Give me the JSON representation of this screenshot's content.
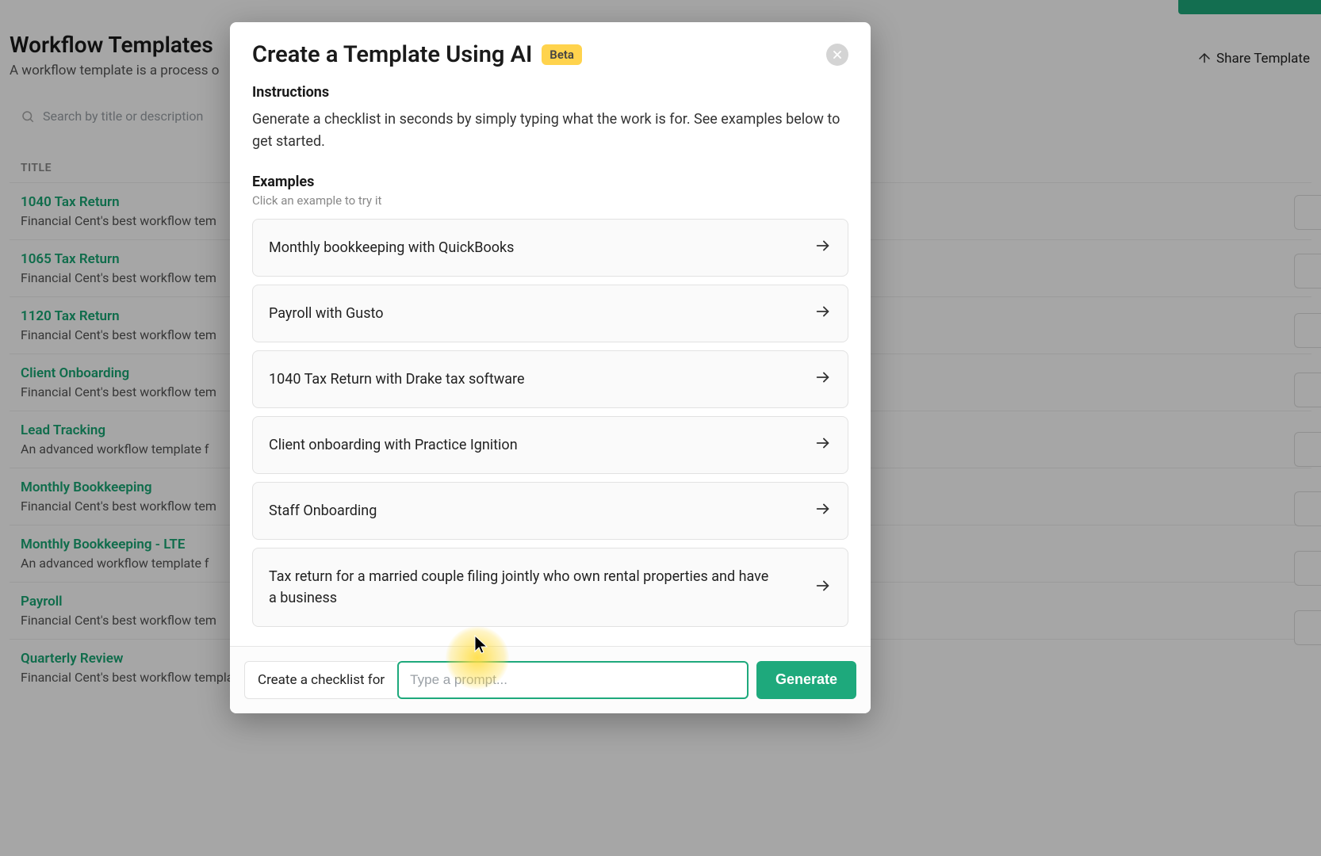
{
  "page": {
    "title": "Workflow Templates",
    "subtitle": "A workflow template is a process o",
    "share_button": "Share Template",
    "search_placeholder": "Search by title or description",
    "column_header": "TITLE",
    "rows": [
      {
        "title": "1040 Tax Return",
        "subtitle": "Financial Cent's best workflow tem"
      },
      {
        "title": "1065 Tax Return",
        "subtitle": "Financial Cent's best workflow tem"
      },
      {
        "title": "1120 Tax Return",
        "subtitle": "Financial Cent's best workflow tem"
      },
      {
        "title": "Client Onboarding",
        "subtitle": "Financial Cent's best workflow tem"
      },
      {
        "title": "Lead Tracking",
        "subtitle": "An advanced workflow template f"
      },
      {
        "title": "Monthly Bookkeeping",
        "subtitle": "Financial Cent's best workflow tem"
      },
      {
        "title": "Monthly Bookkeeping - LTE",
        "subtitle": "An advanced workflow template f"
      },
      {
        "title": "Payroll",
        "subtitle": "Financial Cent's best workflow tem"
      },
      {
        "title": "Quarterly Review",
        "subtitle": "Financial Cent's best workflow template for your quarterly review process"
      }
    ]
  },
  "modal": {
    "title": "Create a Template Using AI",
    "badge": "Beta",
    "instructions_heading": "Instructions",
    "instructions_text": "Generate a checklist in seconds by simply typing what the work is for. See examples below to get started.",
    "examples_heading": "Examples",
    "examples_sub": "Click an example to try it",
    "examples": [
      "Monthly bookkeeping with QuickBooks",
      "Payroll with Gusto",
      "1040 Tax Return with Drake tax software",
      "Client onboarding with Practice Ignition",
      "Staff Onboarding",
      "Tax return for a married couple filing jointly who own rental properties and have a business"
    ],
    "footer": {
      "prefix": "Create a checklist for",
      "placeholder": "Type a prompt...",
      "generate": "Generate"
    }
  }
}
